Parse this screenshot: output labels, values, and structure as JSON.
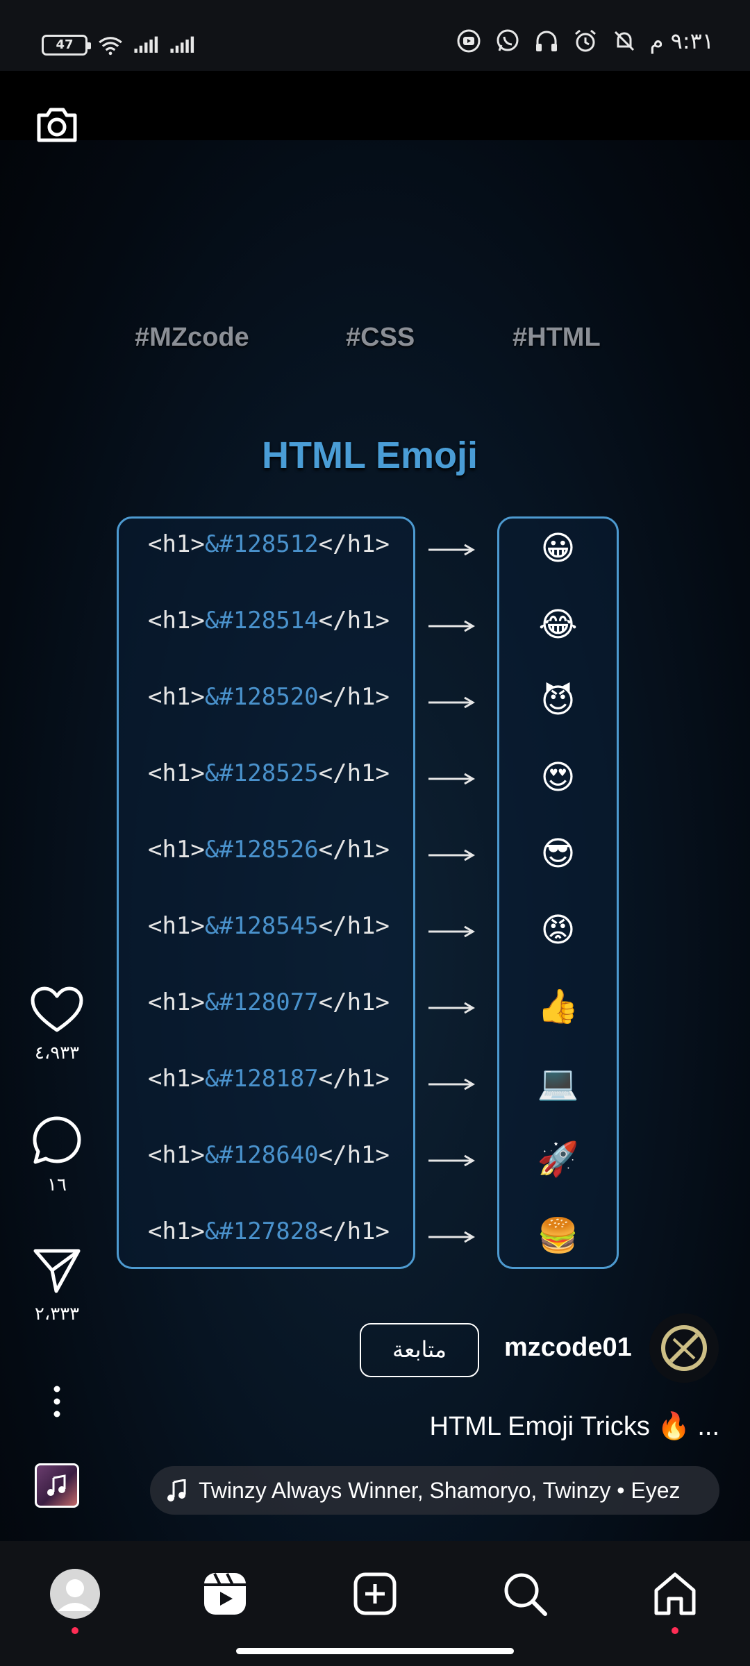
{
  "status_bar": {
    "battery": "47",
    "time": "٩:٣١ م"
  },
  "video": {
    "hashtags": [
      "#MZcode",
      "#CSS",
      "#HTML"
    ],
    "title": "HTML Emoji",
    "rows": [
      {
        "open": "<h1>",
        "code": "&#128512",
        "close": "</h1>",
        "emoji": "😀"
      },
      {
        "open": "<h1>",
        "code": "&#128514",
        "close": "</h1>",
        "emoji": "😂"
      },
      {
        "open": "<h1>",
        "code": "&#128520",
        "close": "</h1>",
        "emoji": "😈"
      },
      {
        "open": "<h1>",
        "code": "&#128525",
        "close": "</h1>",
        "emoji": "😍"
      },
      {
        "open": "<h1>",
        "code": "&#128526",
        "close": "</h1>",
        "emoji": "😎"
      },
      {
        "open": "<h1>",
        "code": "&#128545",
        "close": "</h1>",
        "emoji": "😡"
      },
      {
        "open": "<h1>",
        "code": "&#128077",
        "close": "</h1>",
        "emoji": "👍"
      },
      {
        "open": "<h1>",
        "code": "&#128187",
        "close": "</h1>",
        "emoji": "💻"
      },
      {
        "open": "<h1>",
        "code": "&#128640",
        "close": "</h1>",
        "emoji": "🚀"
      },
      {
        "open": "<h1>",
        "code": "&#127828",
        "close": "</h1>",
        "emoji": "🍔"
      }
    ],
    "arrow_icon": "long-right-arrow"
  },
  "actions": {
    "likes": "٤،٩٣٣",
    "comments": "١٦",
    "shares": "٢،٣٣٣"
  },
  "post": {
    "follow_label": "متابعة",
    "username": "mzcode01",
    "caption": "HTML Emoji Tricks 🔥 ...",
    "music": "Twinzy Always Winner, Shamoryo, Twinzy • Eyez"
  },
  "nav": [
    "profile",
    "reels",
    "create",
    "search",
    "home"
  ],
  "colors": {
    "accent_blue": "#4a9dd6",
    "notification_dot": "#ff2d55"
  }
}
